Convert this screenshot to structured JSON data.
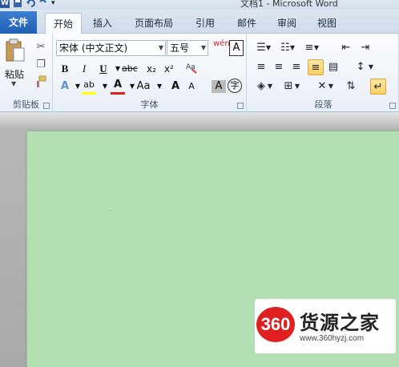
{
  "window": {
    "title": "文档1 - Microsoft Word"
  },
  "tabs": [
    "文件",
    "开始",
    "插入",
    "页面布局",
    "引用",
    "邮件",
    "审阅",
    "视图"
  ],
  "clipboard": {
    "paste_label": "粘贴",
    "group_label": "剪贴板"
  },
  "font": {
    "name": "宋体 (中文正文)",
    "size": "五号",
    "bold": "B",
    "italic": "I",
    "underline": "U",
    "strike": "abc",
    "subscript": "x₂",
    "superscript": "x²",
    "change_case": "Aa",
    "grow": "A",
    "shrink": "A",
    "font_color": "A",
    "highlight": "ab",
    "char_border": "A",
    "char_shading": "A",
    "enclose": "字",
    "phonetic": "wén",
    "group_label": "字体"
  },
  "paragraph": {
    "group_label": "段落"
  },
  "watermark": {
    "badge": "360",
    "brand": "货源之家",
    "url": "www.360hyzj.com"
  },
  "colors": {
    "page": "#b3dfb2",
    "file_tab": "#2b67bf",
    "accent": "#f9cf63",
    "font_color_bar": "#e02020",
    "highlight_bar": "#ffff00"
  }
}
